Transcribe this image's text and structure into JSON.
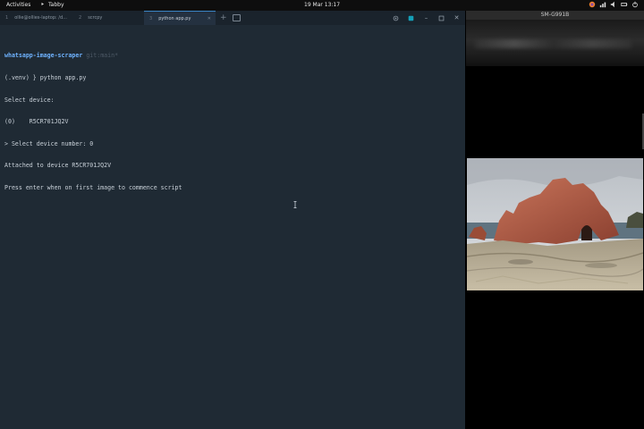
{
  "topbar": {
    "activities": "Activities",
    "app_name": "Tabby",
    "clock": "19 Mar  13:17",
    "tray_icons": [
      "firefox-icon",
      "network-icon",
      "volume-icon",
      "battery-icon",
      "power-icon"
    ]
  },
  "tabby": {
    "tabs": [
      {
        "num": "1",
        "label": "ollie@ollies-laptop: /d...",
        "active": false
      },
      {
        "num": "2",
        "label": "scrcpy",
        "active": false
      },
      {
        "num": "3",
        "label": "python app.py",
        "active": true
      }
    ],
    "terminal": {
      "prompt_dir": "whatsapp-image-scraper",
      "prompt_branch": "git:main*",
      "lines": [
        "(.venv) } python app.py",
        "Select device:",
        "(0)    R5CR701JQ2V",
        "> Select device number: 0",
        "Attached to device R5CR701JQ2V",
        "Press enter when on first image to commence script"
      ]
    },
    "colors": {
      "background": "#1f2a34",
      "tabbar": "#1a232c",
      "accent": "#3a84c6"
    }
  },
  "phone": {
    "window_title": "SM-G991B",
    "photo_icon": "rock-arch-coast-photo"
  }
}
